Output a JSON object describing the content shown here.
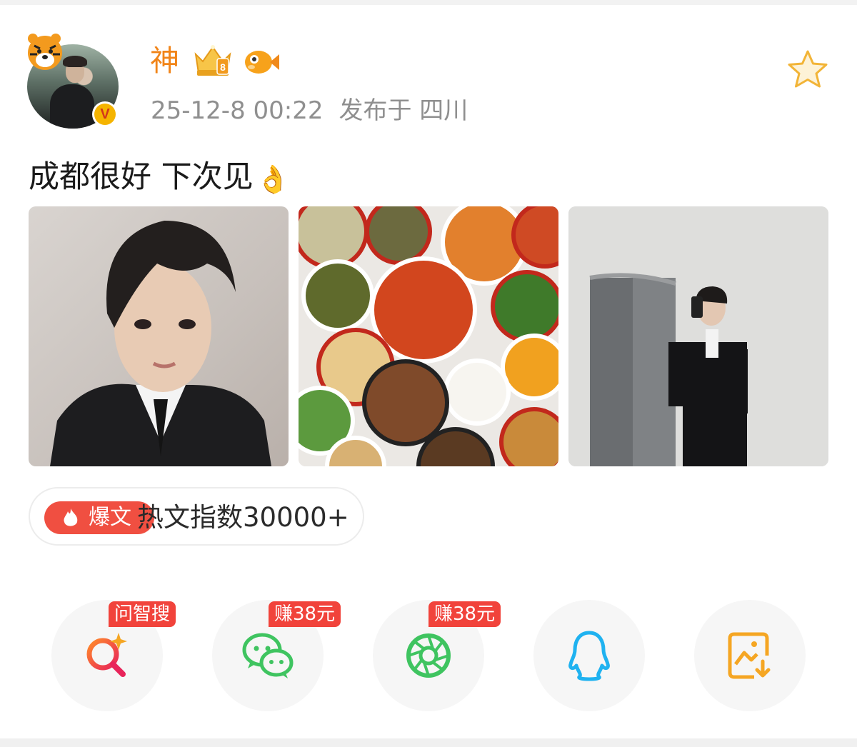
{
  "post": {
    "username": "神",
    "timestamp": "25-12-8 00:22",
    "location": "发布于 四川",
    "text": "成都很好 下次见",
    "emoji": "👌"
  },
  "badges": {
    "verified": "V",
    "level": "8"
  },
  "hot": {
    "label": "爆文",
    "index_text": "热文指数30000+"
  },
  "share": {
    "items": [
      {
        "name": "ai-search",
        "tag": "问智搜"
      },
      {
        "name": "wechat",
        "tag": "赚38元"
      },
      {
        "name": "moments",
        "tag": "赚38元"
      },
      {
        "name": "qq",
        "tag": ""
      },
      {
        "name": "save-image",
        "tag": ""
      }
    ]
  },
  "colors": {
    "accent_orange": "#f18418",
    "hot_red": "#f04f41",
    "tag_red": "#f1433b",
    "wechat_green": "#3fc460",
    "qq_blue": "#1fb2f0",
    "save_orange": "#f5a623"
  }
}
